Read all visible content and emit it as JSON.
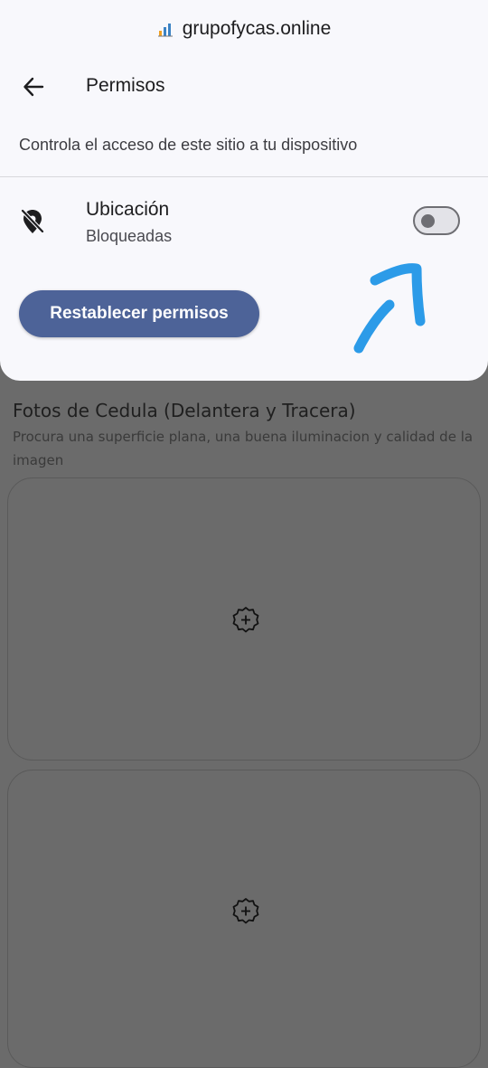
{
  "browser": {
    "url": "grupofycas.online",
    "site_icon": "bar-chart-icon"
  },
  "permissions_sheet": {
    "back_icon": "arrow-left-icon",
    "title": "Permisos",
    "description": "Controla el acceso de este sitio a tu dispositivo",
    "items": [
      {
        "icon": "location-off-icon",
        "name": "Ubicación",
        "status": "Bloqueadas",
        "enabled": false
      }
    ],
    "reset_button_label": "Restablecer permisos"
  },
  "background_page": {
    "section_title": "Fotos de Cedula (Delantera y Tracera)",
    "section_subtitle": "Procura una superficie plana, una buena iluminacion y calidad de la imagen",
    "upload_slots": [
      {
        "icon": "add-circle-icon"
      },
      {
        "icon": "add-circle-icon"
      }
    ]
  },
  "annotation": {
    "type": "arrow-drawing",
    "color": "#2c9be8"
  },
  "colors": {
    "button_bg": "#4d6398",
    "sheet_bg": "#f8f8fc",
    "dim_bg": "#6b6b6b"
  }
}
